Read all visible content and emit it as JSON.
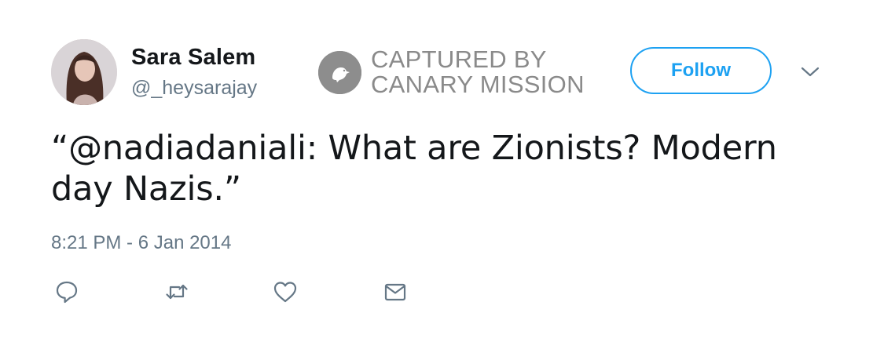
{
  "user": {
    "display_name": "Sara Salem",
    "handle": "@_heysarajay"
  },
  "watermark": {
    "line1": "CAPTURED BY",
    "line2": "CANARY MISSION",
    "icon": "canary-bird-icon"
  },
  "follow_button": {
    "label": "Follow"
  },
  "tweet": {
    "text_line1": "“@nadiadaniali: What are Zionists? Modern",
    "text_line2": "day Nazis.”",
    "timestamp": "8:21 PM - 6 Jan 2014"
  },
  "actions": [
    {
      "icon": "reply-icon"
    },
    {
      "icon": "retweet-icon"
    },
    {
      "icon": "like-icon"
    },
    {
      "icon": "message-icon"
    }
  ],
  "colors": {
    "accent": "#1da1f2",
    "secondary_text": "#657786",
    "primary_text": "#14171a",
    "watermark": "#8a8a8a"
  }
}
